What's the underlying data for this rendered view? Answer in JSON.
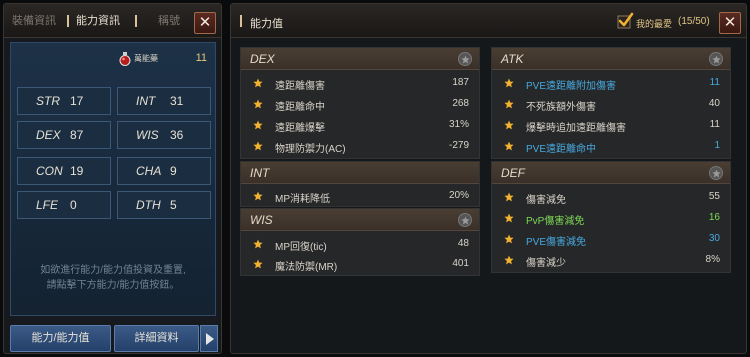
{
  "left": {
    "tabs": [
      {
        "label": "裝備資訊"
      },
      {
        "label": "能力資訊"
      },
      {
        "label": "稱號"
      }
    ],
    "close_label": "✕",
    "bonus_label": "萬能藥",
    "bonus_value": "11",
    "stats": [
      {
        "name": "STR",
        "value": "17"
      },
      {
        "name": "INT",
        "value": "31"
      },
      {
        "name": "DEX",
        "value": "87"
      },
      {
        "name": "WIS",
        "value": "36"
      },
      {
        "name": "CON",
        "value": "19"
      },
      {
        "name": "CHA",
        "value": "9"
      },
      {
        "name": "LFE",
        "value": "0"
      },
      {
        "name": "DTH",
        "value": "5"
      }
    ],
    "hint_line1": "如欲進行能力/能力值投資及重置,",
    "hint_line2": "請點擊下方能力/能力值按鈕。",
    "btn_stats": "能力/能力值",
    "btn_detail": "詳細資料"
  },
  "right": {
    "title": "能力值",
    "favorites_label": "我的最愛",
    "favorites_count": "(15/50)",
    "close_label": "✕",
    "sections": {
      "dex": {
        "title": "DEX",
        "rows": [
          {
            "label": "遠距離傷害",
            "value": "187"
          },
          {
            "label": "遠距離命中",
            "value": "268"
          },
          {
            "label": "遠距離爆擊",
            "value": "31%"
          },
          {
            "label": "物理防禦力(AC)",
            "value": "-279"
          }
        ]
      },
      "int": {
        "title": "INT",
        "rows": [
          {
            "label": "MP消耗降低",
            "value": "20%"
          }
        ]
      },
      "wis": {
        "title": "WIS",
        "rows": [
          {
            "label": "MP回復(tic)",
            "value": "48"
          },
          {
            "label": "魔法防禦(MR)",
            "value": "401"
          }
        ]
      },
      "atk": {
        "title": "ATK",
        "rows": [
          {
            "label": "PVE遠距離附加傷害",
            "value": "11",
            "color": "blue"
          },
          {
            "label": "不死族額外傷害",
            "value": "40"
          },
          {
            "label": "爆擊時追加遠距離傷害",
            "value": "11"
          },
          {
            "label": "PVE遠距離命中",
            "value": "1",
            "color": "blue"
          }
        ]
      },
      "def": {
        "title": "DEF",
        "rows": [
          {
            "label": "傷害減免",
            "value": "55"
          },
          {
            "label": "PvP傷害減免",
            "value": "16",
            "color": "green"
          },
          {
            "label": "PVE傷害減免",
            "value": "30",
            "color": "blue"
          },
          {
            "label": "傷害減少",
            "value": "8%"
          }
        ]
      }
    }
  },
  "colors": {
    "accent_gold": "#f2b230",
    "pve_blue": "#47a9e0",
    "pvp_green": "#7ed957"
  }
}
